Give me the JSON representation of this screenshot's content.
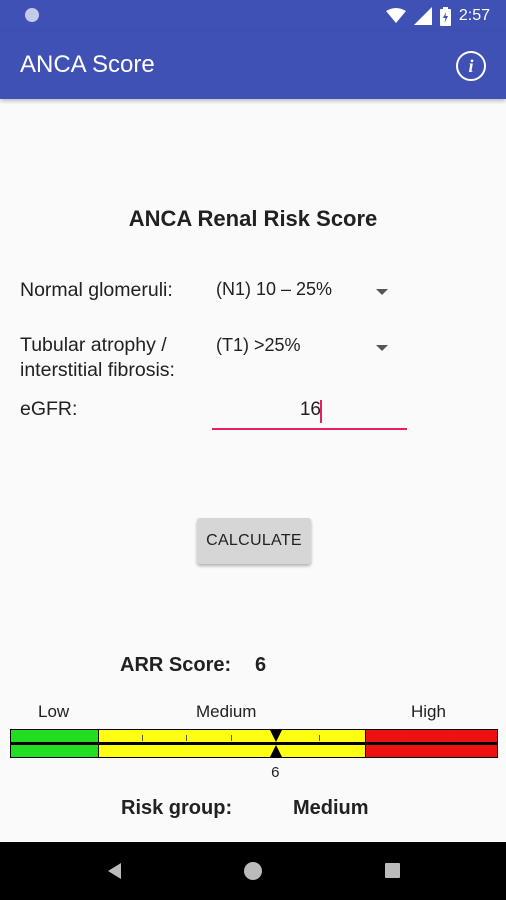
{
  "status_bar": {
    "time": "2:57"
  },
  "app_bar": {
    "title": "ANCA Score"
  },
  "form": {
    "heading": "ANCA Renal Risk Score",
    "glomeruli_label": "Normal glomeruli:",
    "glomeruli_value": "(N1) 10 – 25%",
    "tubular_label_1": "Tubular atrophy /",
    "tubular_label_2": "interstitial fibrosis:",
    "tubular_value": "(T1) >25%",
    "egfr_label": "eGFR:",
    "egfr_value": "16"
  },
  "calculate_label": "CALCULATE",
  "result": {
    "arr_label": "ARR Score:",
    "arr_value": "6",
    "scale_low": "Low",
    "scale_medium": "Medium",
    "scale_high": "High",
    "marker_value": "6",
    "gauge_max": 11,
    "risk_label": "Risk group:",
    "risk_value": "Medium"
  },
  "colors": {
    "primary": "#3f51b5",
    "accent": "#e91e63",
    "low": "#22dd22",
    "medium": "#ffff11",
    "high": "#ee1111"
  },
  "icons": [
    "circle-notification-icon",
    "wifi-icon",
    "signal-icon",
    "battery-icon",
    "info-icon",
    "back-icon",
    "home-icon",
    "recents-icon"
  ]
}
